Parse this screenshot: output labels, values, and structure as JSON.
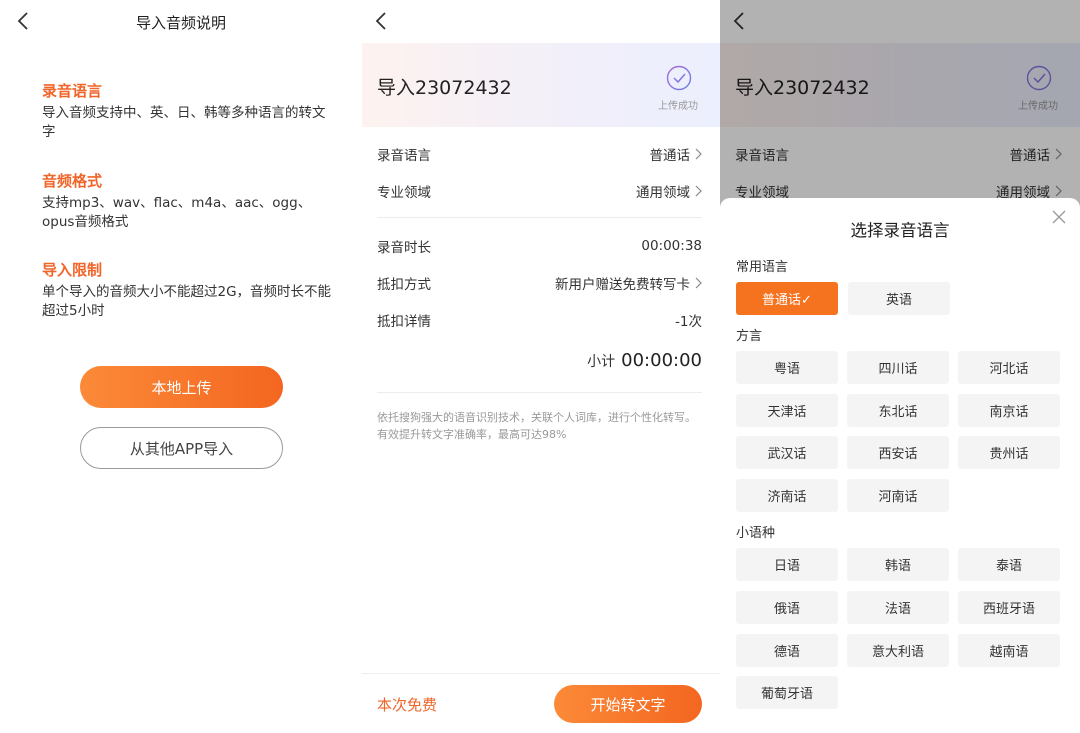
{
  "colors": {
    "accent": "#f0652a",
    "button_gradient_start": "#fb8a38",
    "button_gradient_end": "#f46620"
  },
  "panel1": {
    "title": "导入音频说明",
    "sections": [
      {
        "title": "录音语言",
        "text": "导入音频支持中、英、日、韩等多种语言的转文字"
      },
      {
        "title": "音频格式",
        "text": "支持mp3、wav、flac、m4a、aac、ogg、opus音频格式"
      },
      {
        "title": "导入限制",
        "text": "单个导入的音频大小不能超过2G，音频时长不能超过5小时"
      }
    ],
    "upload_local": "本地上传",
    "import_other": "从其他APP导入"
  },
  "detail": {
    "file_title": "导入23072432",
    "upload_status": "上传成功",
    "rows": [
      {
        "label": "录音语言",
        "value": "普通话",
        "chevron": true
      },
      {
        "label": "专业领域",
        "value": "通用领域",
        "chevron": true
      },
      {
        "label": "录音时长",
        "value": "00:00:38",
        "chevron": false
      },
      {
        "label": "抵扣方式",
        "value": "新用户赠送免费转写卡",
        "chevron": true
      },
      {
        "label": "抵扣详情",
        "value": "-1次",
        "chevron": false
      }
    ],
    "subtotal_label": "小计",
    "subtotal_value": "00:00:00",
    "note_line1": "依托搜狗强大的语音识别技术，关联个人词库，进行个性化转写。",
    "note_line2": "有效提升转文字准确率，最高可达98%",
    "free_label": "本次免费",
    "start_button": "开始转文字"
  },
  "language_sheet": {
    "title": "选择录音语言",
    "common_title": "常用语言",
    "common": [
      "普通话✓",
      "英语"
    ],
    "dialect_title": "方言",
    "dialects": [
      "粤语",
      "四川话",
      "河北话",
      "天津话",
      "东北话",
      "南京话",
      "武汉话",
      "西安话",
      "贵州话",
      "济南话",
      "河南话"
    ],
    "minor_title": "小语种",
    "minor": [
      "日语",
      "韩语",
      "泰语",
      "俄语",
      "法语",
      "西班牙语",
      "德语",
      "意大利语",
      "越南语",
      "葡萄牙语"
    ]
  }
}
